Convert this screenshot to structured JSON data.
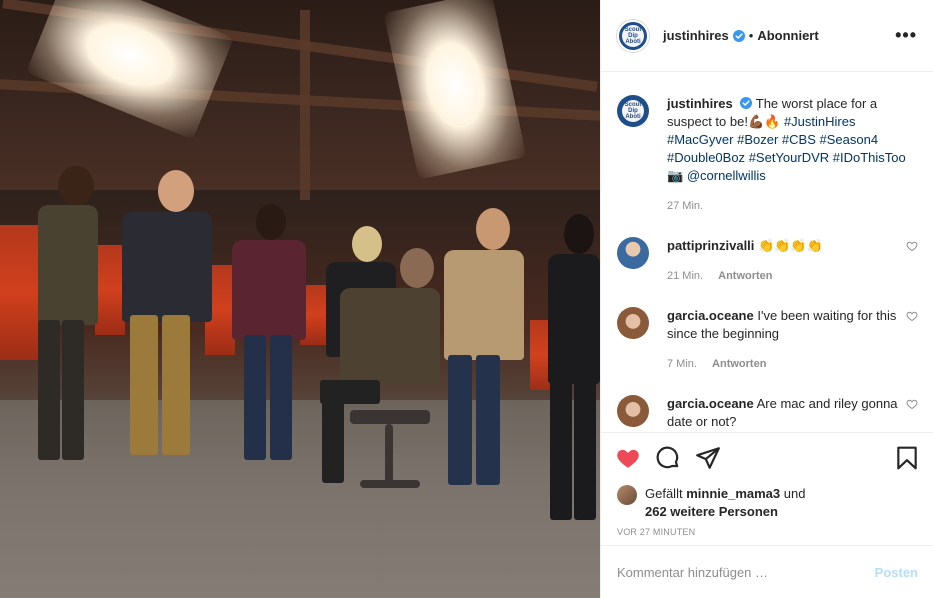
{
  "post": {
    "username": "justinhires",
    "follow_status": "Abonniert",
    "more_label": "•••",
    "caption": {
      "text": "The worst place for a suspect to be!💪🏾🔥",
      "hashtags": [
        "#JustinHires",
        "#MacGyver",
        "#Bozer",
        "#CBS",
        "#Season4",
        "#Double0Boz",
        "#SetYourDVR",
        "#IDoThisToo"
      ],
      "camera_emoji": "📷",
      "mention": "@cornellwillis",
      "time": "27 Min."
    },
    "comments": [
      {
        "user": "pattiprinzivalli",
        "text": "👏👏👏👏",
        "time": "21 Min.",
        "reply_label": "Antworten"
      },
      {
        "user": "garcia.oceane",
        "text": "I've been waiting for this since the beginning",
        "time": "7 Min.",
        "reply_label": "Antworten"
      },
      {
        "user": "garcia.oceane",
        "text": "Are mac and riley gonna date or not?",
        "time": "",
        "reply_label": ""
      }
    ],
    "likes": {
      "prefix": "Gefällt",
      "user": "minnie_mama3",
      "conj": "und",
      "others": "262 weitere Personen"
    },
    "posted_ago": "VOR 27 MINUTEN",
    "add_comment": {
      "placeholder": "Kommentar hinzufügen …",
      "post_label": "Posten"
    },
    "avatar_text": "Scout Dip Aboti",
    "colors": {
      "liked_heart": "#ed4956",
      "link": "#00376b",
      "post_disabled": "#b2dffc",
      "verified": "#3897f0"
    },
    "icons": [
      "more-icon",
      "verified-icon",
      "heart-icon",
      "comment-icon",
      "share-icon",
      "bookmark-icon"
    ]
  }
}
